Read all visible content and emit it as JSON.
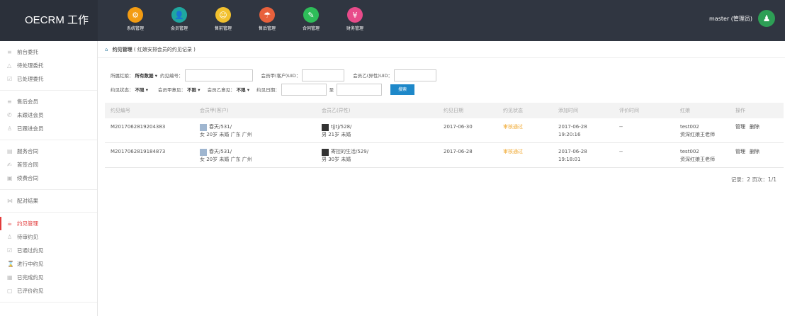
{
  "brand": "OECRM 工作台",
  "nav": [
    {
      "label": "系统管理",
      "icon": "gear-icon",
      "color": "#f39c12",
      "glyph": "⚙"
    },
    {
      "label": "会员管理",
      "icon": "user-icon",
      "color": "#1fa7a0",
      "glyph": "👤"
    },
    {
      "label": "售前管理",
      "icon": "face-icon",
      "color": "#f2c12e",
      "glyph": "☺"
    },
    {
      "label": "售后管理",
      "icon": "umbrella-icon",
      "color": "#e8613c",
      "glyph": "☂"
    },
    {
      "label": "合同管理",
      "icon": "edit-icon",
      "color": "#2ebd59",
      "glyph": "✎"
    },
    {
      "label": "财务管理",
      "icon": "money-icon",
      "color": "#e84b8a",
      "glyph": "¥"
    }
  ],
  "user": {
    "name": "master (管理员)"
  },
  "sidebar": [
    {
      "items": [
        {
          "label": "前台委托",
          "icon": "list-icon",
          "glyph": "≡"
        },
        {
          "label": "待处理委托",
          "icon": "warning-icon",
          "glyph": "△"
        },
        {
          "label": "已处理委托",
          "icon": "check-icon",
          "glyph": "☑"
        }
      ]
    },
    {
      "items": [
        {
          "label": "售后会员",
          "icon": "list-icon",
          "glyph": "≡"
        },
        {
          "label": "未跟进会员",
          "icon": "phone-icon",
          "glyph": "✆"
        },
        {
          "label": "已跟进会员",
          "icon": "person-icon",
          "glyph": "♙"
        }
      ]
    },
    {
      "items": [
        {
          "label": "服务合同",
          "icon": "doc-icon",
          "glyph": "▤"
        },
        {
          "label": "首签合同",
          "icon": "sign-icon",
          "glyph": "✍"
        },
        {
          "label": "续费合同",
          "icon": "renew-icon",
          "glyph": "▣"
        }
      ]
    },
    {
      "items": [
        {
          "label": "配对结果",
          "icon": "pair-icon",
          "glyph": "⋈"
        }
      ]
    },
    {
      "items": [
        {
          "label": "约见管理",
          "icon": "cup-icon",
          "glyph": "☕",
          "active": true
        },
        {
          "label": "待审约见",
          "icon": "person-icon",
          "glyph": "♙"
        },
        {
          "label": "已通过约见",
          "icon": "check-icon",
          "glyph": "☑"
        },
        {
          "label": "进行中约见",
          "icon": "hourglass-icon",
          "glyph": "⌛"
        },
        {
          "label": "已完成约见",
          "icon": "done-icon",
          "glyph": "▦"
        },
        {
          "label": "已评价约见",
          "icon": "comment-icon",
          "glyph": "▢"
        }
      ]
    }
  ],
  "crumb": {
    "title": "约见管理",
    "note": "( 红娘安排会员的约见记录 )"
  },
  "filters": {
    "matchmaker_label": "所属红娘：",
    "matchmaker_value": "所有数据 ▾",
    "appt_no_label": "约见编号：",
    "member_a_label": "会员甲(客户)UID：",
    "member_b_label": "会员乙(异性)UID：",
    "status_label": "约见状态：",
    "status_value": "不限 ▾",
    "a_opinion_label": "会员甲意见：",
    "a_opinion_value": "不限 ▾",
    "b_opinion_label": "会员乙意见：",
    "b_opinion_value": "不限 ▾",
    "date_label": "约见日期：",
    "to_label": "至",
    "search_label": "搜索"
  },
  "table": {
    "headers": [
      "约见编号",
      "会员甲(客户)",
      "会员乙(异性)",
      "约见日期",
      "约见状态",
      "添加时间",
      "评价时间",
      "红娘",
      "操作"
    ],
    "rows": [
      {
        "no": "M2017062819204383",
        "a_name": "春天/531/",
        "a_info": "女 20岁 未婚 广东 广州",
        "b_name": "tjjtj/528/",
        "b_info": "男 21岁 未婚",
        "date": "2017-06-30",
        "status": "审核通过",
        "add_date": "2017-06-28",
        "add_time": "19:20:16",
        "eval": "--",
        "mm1": "test002",
        "mm2": "资深红娘王老师",
        "op1": "管理",
        "op2": "删除"
      },
      {
        "no": "M2017062819184873",
        "a_name": "春天/531/",
        "a_info": "女 20岁 未婚 广东 广州",
        "b_name": "寄控的生活/529/",
        "b_info": "男 30岁 未婚",
        "date": "2017-06-28",
        "status": "审核通过",
        "add_date": "2017-06-28",
        "add_time": "19:18:01",
        "eval": "--",
        "mm1": "test002",
        "mm2": "资深红娘王老师",
        "op1": "管理",
        "op2": "删除"
      }
    ]
  },
  "pager": "记录：2  页次：1/1"
}
